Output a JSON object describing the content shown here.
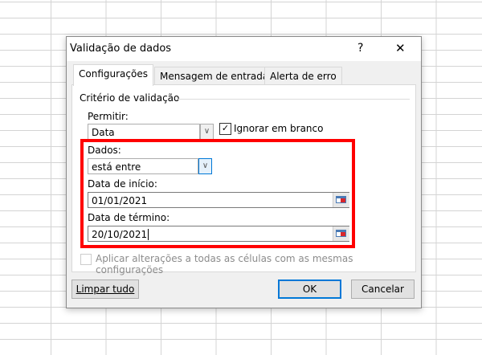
{
  "dialog": {
    "title": "Validação de dados",
    "help_label": "?",
    "close_label": "✕"
  },
  "tabs": [
    {
      "label": "Configurações",
      "active": true
    },
    {
      "label": "Mensagem de entrada",
      "active": false
    },
    {
      "label": "Alerta de erro",
      "active": false
    }
  ],
  "section_title": "Critério de validação",
  "permitir": {
    "label": "Permitir:",
    "value": "Data"
  },
  "ignorar": {
    "label": "Ignorar em branco",
    "checked": true
  },
  "dados": {
    "label": "Dados:",
    "value": "está entre"
  },
  "data_inicio": {
    "label": "Data de início:",
    "value": "01/01/2021"
  },
  "data_termino": {
    "label": "Data de término:",
    "value": "20/10/2021"
  },
  "aplicar": {
    "label": "Aplicar alterações a todas as células com as mesmas configurações",
    "checked": false
  },
  "buttons": {
    "clear": "Limpar tudo",
    "ok": "OK",
    "cancel": "Cancelar"
  },
  "colors": {
    "highlight": "#ff0000",
    "accent": "#0078d7"
  }
}
